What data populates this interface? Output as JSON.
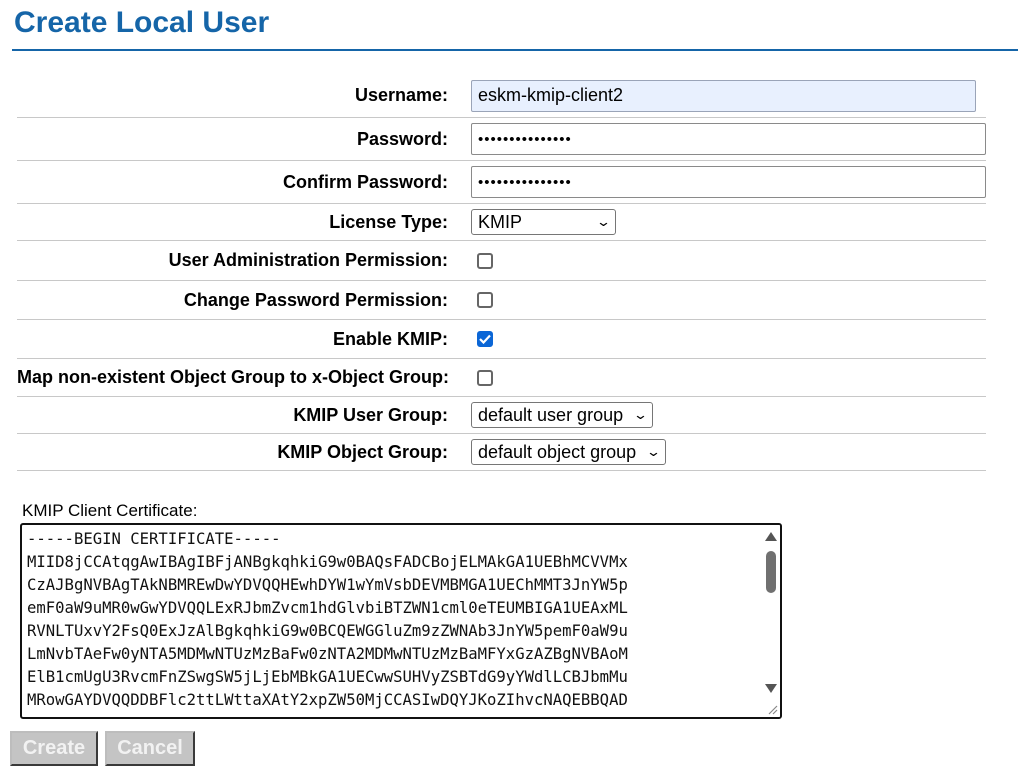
{
  "page": {
    "title": "Create Local User"
  },
  "form": {
    "username_label": "Username:",
    "username_value": "eskm-kmip-client2",
    "password_label": "Password:",
    "password_value": "•••••••••••••••",
    "confirm_label": "Confirm Password:",
    "confirm_value": "•••••••••••••••",
    "license_label": "License Type:",
    "license_value": "KMIP",
    "user_admin_label": "User Administration Permission:",
    "user_admin_checked": false,
    "change_pw_label": "Change Password Permission:",
    "change_pw_checked": false,
    "enable_kmip_label": "Enable KMIP:",
    "enable_kmip_checked": true,
    "map_group_label": "Map non-existent Object Group to x-Object Group:",
    "map_group_checked": false,
    "kmip_user_group_label": "KMIP User Group:",
    "kmip_user_group_value": "default user group",
    "kmip_object_group_label": "KMIP Object Group:",
    "kmip_object_group_value": "default object group"
  },
  "certificate": {
    "label": "KMIP Client Certificate:",
    "text": "-----BEGIN CERTIFICATE-----\nMIID8jCCAtqgAwIBAgIBFjANBgkqhkiG9w0BAQsFADCBojELMAkGA1UEBhMCVVMx\nCzAJBgNVBAgTAkNBMREwDwYDVQQHEwhDYW1wYmVsbDEVMBMGA1UEChMMT3JnYW5p\nemF0aW9uMR0wGwYDVQQLExRJbmZvcm1hdGlvbiBTZWN1cml0eTEUMBIGA1UEAxML\nRVNLTUxvY2FsQ0ExJzAlBgkqhkiG9w0BCQEWGGluZm9zZWNAb3JnYW5pemF0aW9u\nLmNvbTAeFw0yNTA5MDMwNTUzMzBaFw0zNTA2MDMwNTUzMzBaMFYxGzAZBgNVBAoM\nElB1cmUgU3RvcmFnZSwgSW5jLjEbMBkGA1UECwwSUHVyZSBTdG9yYWdlLCBJbmMu\nMRowGAYDVQQDDBFlc2ttLWttaXAtY2xpZW50MjCCASIwDQYJKoZIhvcNAQEBBQAD"
  },
  "buttons": {
    "create": "Create",
    "cancel": "Cancel"
  }
}
